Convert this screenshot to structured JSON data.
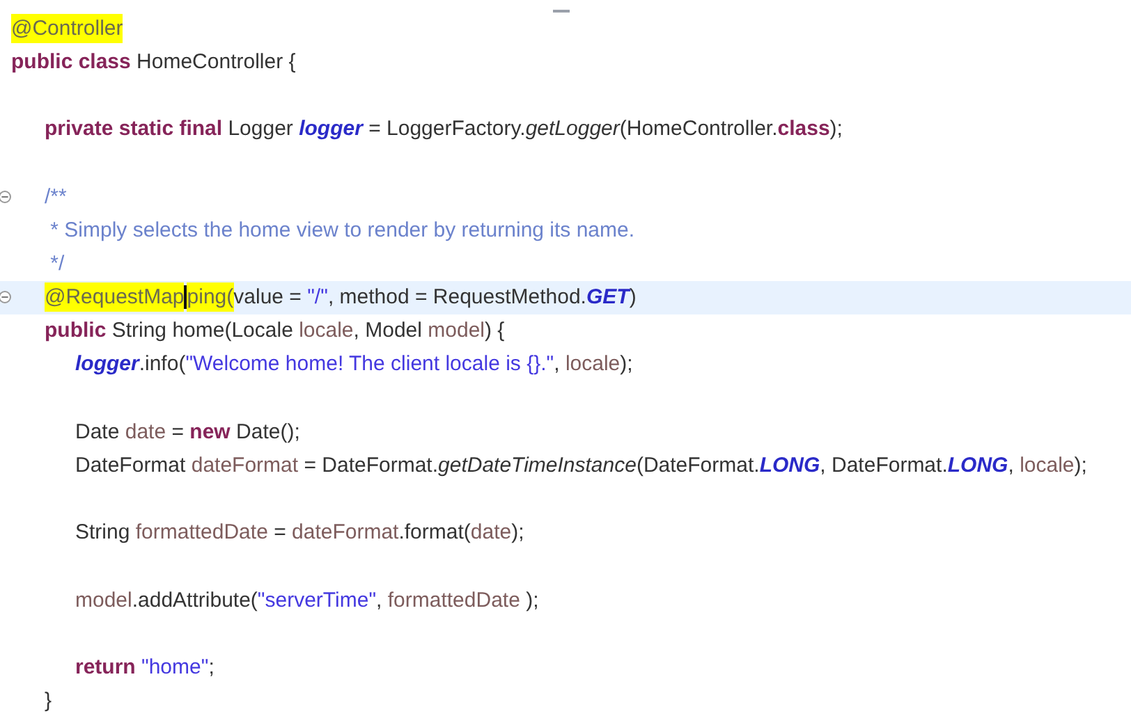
{
  "editor": {
    "lines": [
      {
        "kind": "top",
        "current": false,
        "fold": false,
        "tokens": [
          {
            "kind": "annotation",
            "text": "@Controller",
            "highlighted": true
          }
        ]
      },
      {
        "kind": "top",
        "current": false,
        "fold": false,
        "tokens": [
          {
            "kind": "kw",
            "text": "public class"
          },
          {
            "kind": "plain",
            "text": " HomeController {"
          }
        ]
      },
      {
        "kind": "blank",
        "current": false,
        "fold": false
      },
      {
        "kind": "member",
        "current": false,
        "fold": false,
        "tokens": [
          {
            "kind": "kw",
            "text": "private static final"
          },
          {
            "kind": "plain",
            "text": " Logger "
          },
          {
            "kind": "field",
            "text": "logger"
          },
          {
            "kind": "plain",
            "text": " = LoggerFactory."
          },
          {
            "kind": "method",
            "text": "getLogger"
          },
          {
            "kind": "plain",
            "text": "(HomeController."
          },
          {
            "kind": "kw",
            "text": "class"
          },
          {
            "kind": "plain",
            "text": ");"
          }
        ]
      },
      {
        "kind": "blank",
        "current": false,
        "fold": false
      },
      {
        "kind": "member",
        "current": false,
        "fold": true,
        "tokens": [
          {
            "kind": "comment",
            "text": "/**"
          }
        ]
      },
      {
        "kind": "member",
        "current": false,
        "fold": false,
        "tokens": [
          {
            "kind": "comment",
            "text": " * Simply selects the home view to render by returning its name."
          }
        ]
      },
      {
        "kind": "member",
        "current": false,
        "fold": false,
        "tokens": [
          {
            "kind": "comment",
            "text": " */"
          }
        ]
      },
      {
        "kind": "member",
        "current": true,
        "fold": true,
        "tokens": [
          {
            "kind": "annotation",
            "text": "@RequestMap",
            "highlighted": true
          },
          {
            "kind": "caret"
          },
          {
            "kind": "annotation",
            "text": "ping(",
            "highlighted": true
          },
          {
            "kind": "plain",
            "text": "value = "
          },
          {
            "kind": "string",
            "text": "\"/\""
          },
          {
            "kind": "plain",
            "text": ", method = RequestMethod."
          },
          {
            "kind": "const",
            "text": "GET"
          },
          {
            "kind": "plain",
            "text": ")"
          }
        ]
      },
      {
        "kind": "member",
        "current": false,
        "fold": false,
        "tokens": [
          {
            "kind": "kw",
            "text": "public"
          },
          {
            "kind": "plain",
            "text": " String home(Locale "
          },
          {
            "kind": "local",
            "text": "locale"
          },
          {
            "kind": "plain",
            "text": ", Model "
          },
          {
            "kind": "local",
            "text": "model"
          },
          {
            "kind": "plain",
            "text": ") {"
          }
        ]
      },
      {
        "kind": "body",
        "current": false,
        "fold": false,
        "tokens": [
          {
            "kind": "field",
            "text": "logger"
          },
          {
            "kind": "plain",
            "text": ".info("
          },
          {
            "kind": "string",
            "text": "\"Welcome home! The client locale is {}.\""
          },
          {
            "kind": "plain",
            "text": ", "
          },
          {
            "kind": "local",
            "text": "locale"
          },
          {
            "kind": "plain",
            "text": ");"
          }
        ]
      },
      {
        "kind": "blank",
        "current": false,
        "fold": false
      },
      {
        "kind": "body",
        "current": false,
        "fold": false,
        "tokens": [
          {
            "kind": "plain",
            "text": "Date "
          },
          {
            "kind": "local",
            "text": "date"
          },
          {
            "kind": "plain",
            "text": " = "
          },
          {
            "kind": "kw",
            "text": "new"
          },
          {
            "kind": "plain",
            "text": " Date();"
          }
        ]
      },
      {
        "kind": "body",
        "current": false,
        "fold": false,
        "tokens": [
          {
            "kind": "plain",
            "text": "DateFormat "
          },
          {
            "kind": "local",
            "text": "dateFormat"
          },
          {
            "kind": "plain",
            "text": " = DateFormat."
          },
          {
            "kind": "method",
            "text": "getDateTimeInstance"
          },
          {
            "kind": "plain",
            "text": "(DateFormat."
          },
          {
            "kind": "const",
            "text": "LONG"
          },
          {
            "kind": "plain",
            "text": ", DateFormat."
          },
          {
            "kind": "const",
            "text": "LONG"
          },
          {
            "kind": "plain",
            "text": ", "
          },
          {
            "kind": "local",
            "text": "locale"
          },
          {
            "kind": "plain",
            "text": ");"
          }
        ]
      },
      {
        "kind": "blank",
        "current": false,
        "fold": false
      },
      {
        "kind": "body",
        "current": false,
        "fold": false,
        "tokens": [
          {
            "kind": "plain",
            "text": "String "
          },
          {
            "kind": "local",
            "text": "formattedDate"
          },
          {
            "kind": "plain",
            "text": " = "
          },
          {
            "kind": "local",
            "text": "dateFormat"
          },
          {
            "kind": "plain",
            "text": ".format("
          },
          {
            "kind": "local",
            "text": "date"
          },
          {
            "kind": "plain",
            "text": ");"
          }
        ]
      },
      {
        "kind": "blank",
        "current": false,
        "fold": false
      },
      {
        "kind": "body",
        "current": false,
        "fold": false,
        "tokens": [
          {
            "kind": "local",
            "text": "model"
          },
          {
            "kind": "plain",
            "text": ".addAttribute("
          },
          {
            "kind": "string",
            "text": "\"serverTime\""
          },
          {
            "kind": "plain",
            "text": ", "
          },
          {
            "kind": "local",
            "text": "formattedDate"
          },
          {
            "kind": "plain",
            "text": " );"
          }
        ]
      },
      {
        "kind": "blank",
        "current": false,
        "fold": false
      },
      {
        "kind": "body",
        "current": false,
        "fold": false,
        "tokens": [
          {
            "kind": "kw",
            "text": "return "
          },
          {
            "kind": "string",
            "text": "\"home\""
          },
          {
            "kind": "plain",
            "text": ";"
          }
        ]
      },
      {
        "kind": "member",
        "current": false,
        "fold": false,
        "tokens": [
          {
            "kind": "plain",
            "text": "}"
          }
        ]
      }
    ]
  }
}
